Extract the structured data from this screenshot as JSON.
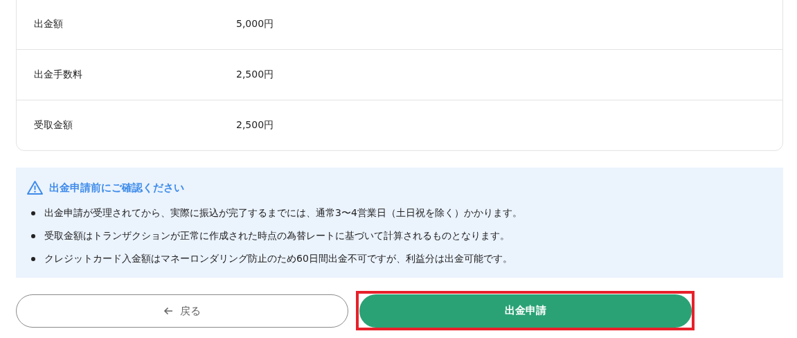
{
  "summary": {
    "rows": [
      {
        "label": "出金額",
        "value": "5,000円"
      },
      {
        "label": "出金手数料",
        "value": "2,500円"
      },
      {
        "label": "受取金額",
        "value": "2,500円"
      }
    ]
  },
  "notice": {
    "title": "出金申請前にご確認ください",
    "items": [
      "出金申請が受理されてから、実際に振込が完了するまでには、通常3〜4営業日（土日祝を除く）かかります。",
      "受取金額はトランザクションが正常に作成された時点の為替レートに基づいて計算されるものとなります。",
      "クレジットカード入金額はマネーロンダリング防止のため60日間出金不可ですが、利益分は出金可能です。"
    ]
  },
  "buttons": [
    {
      "kind": "back",
      "label": "戻る",
      "highlighted": false
    },
    {
      "kind": "primary",
      "label": "出金申請",
      "highlighted": true
    }
  ]
}
